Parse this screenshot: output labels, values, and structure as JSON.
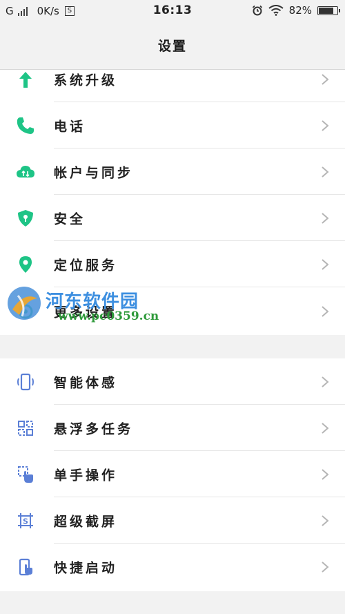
{
  "status_bar": {
    "carrier": "G",
    "net_speed": "0K/s",
    "sim_indicator": "S",
    "time": "16:13",
    "battery_percent": "82%",
    "battery_level": 0.82,
    "icons": [
      "signal-bars-icon",
      "alarm-icon",
      "wifi-icon",
      "battery-icon"
    ]
  },
  "header": {
    "title": "设置"
  },
  "groups": [
    {
      "items": [
        {
          "label": "系统升级",
          "icon": "arrow-up-icon",
          "color": "#1ec486"
        },
        {
          "label": "电话",
          "icon": "phone-icon",
          "color": "#1ec486"
        },
        {
          "label": "帐户与同步",
          "icon": "cloud-sync-icon",
          "color": "#1ec486"
        },
        {
          "label": "安全",
          "icon": "shield-lock-icon",
          "color": "#1ec486"
        },
        {
          "label": "定位服务",
          "icon": "location-pin-icon",
          "color": "#1ec486"
        },
        {
          "label": "更多设置",
          "icon": "more-settings-icon",
          "color": "#1ec486"
        }
      ]
    },
    {
      "items": [
        {
          "label": "智能体感",
          "icon": "motion-phone-icon",
          "color": "#5b7fd6"
        },
        {
          "label": "悬浮多任务",
          "icon": "multitask-icon",
          "color": "#5b7fd6"
        },
        {
          "label": "单手操作",
          "icon": "one-hand-icon",
          "color": "#5b7fd6"
        },
        {
          "label": "超级截屏",
          "icon": "screenshot-icon",
          "color": "#5b7fd6"
        },
        {
          "label": "快捷启动",
          "icon": "quick-launch-icon",
          "color": "#5b7fd6"
        }
      ]
    }
  ],
  "watermark": {
    "title": "河东软件园",
    "url": "www.pc0359.cn"
  }
}
